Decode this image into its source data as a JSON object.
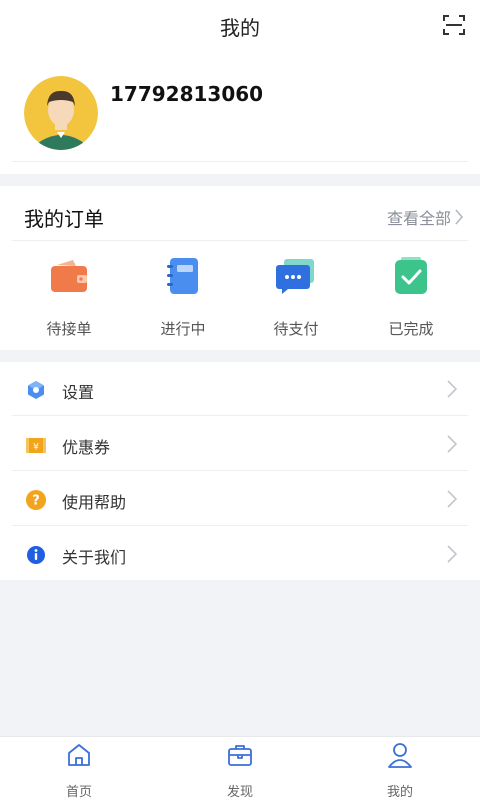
{
  "header": {
    "title": "我的"
  },
  "profile": {
    "phone": "17792813060"
  },
  "orders": {
    "title": "我的订单",
    "view_all": "查看全部",
    "items": [
      {
        "label": "待接单",
        "icon": "wallet-icon"
      },
      {
        "label": "进行中",
        "icon": "notebook-icon"
      },
      {
        "label": "待支付",
        "icon": "chat-icon"
      },
      {
        "label": "已完成",
        "icon": "check-icon"
      }
    ]
  },
  "menu": {
    "items": [
      {
        "label": "设置",
        "icon": "settings-icon"
      },
      {
        "label": "优惠券",
        "icon": "coupon-icon"
      },
      {
        "label": "使用帮助",
        "icon": "help-icon"
      },
      {
        "label": "关于我们",
        "icon": "info-icon"
      }
    ]
  },
  "tabbar": {
    "items": [
      {
        "label": "首页",
        "icon": "home-icon"
      },
      {
        "label": "发现",
        "icon": "briefcase-icon"
      },
      {
        "label": "我的",
        "icon": "person-icon"
      }
    ]
  },
  "colors": {
    "accent_blue": "#3b6fd8",
    "orange": "#f07a4a",
    "green": "#3dc48c",
    "gold": "#f2a41c"
  }
}
